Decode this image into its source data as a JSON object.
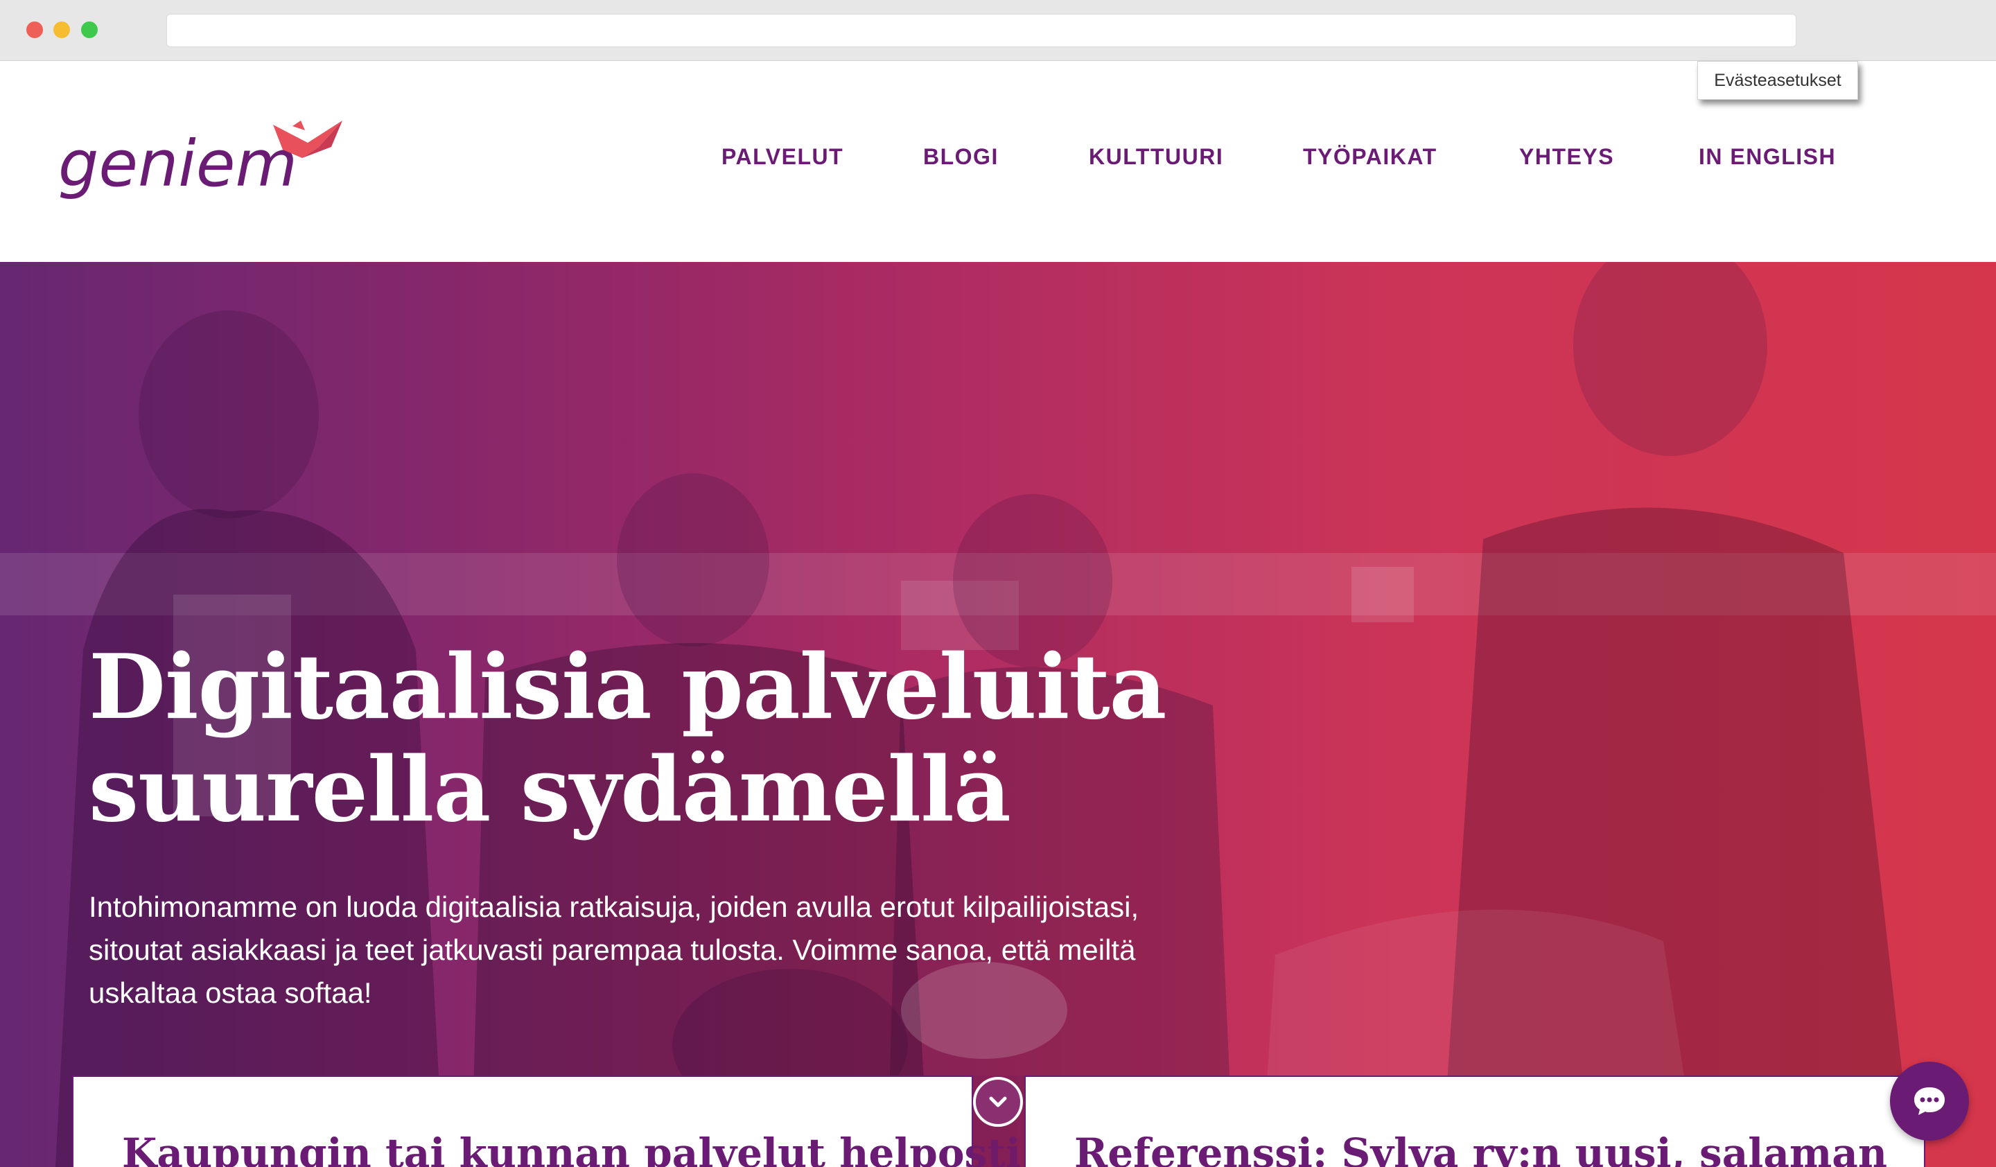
{
  "browser": {
    "buttons": [
      "close",
      "minimize",
      "maximize"
    ],
    "url": ""
  },
  "header": {
    "logo_text": "geniem",
    "cookie_settings": "Evästeasetukset",
    "nav": [
      {
        "label": "PALVELUT"
      },
      {
        "label": "BLOGI"
      },
      {
        "label": "KULTTUURI"
      },
      {
        "label": "TYÖPAIKAT"
      },
      {
        "label": "YHTEYS"
      },
      {
        "label": "IN ENGLISH"
      }
    ]
  },
  "hero": {
    "title": "Digitaalisia palveluita suurella sydämellä",
    "text": "Intohimonamme on luoda digitaalisia ratkaisuja, joiden avulla erotut kilpailijoistasi, sitoutat asiakkaasi ja teet jatkuvasti parempaa tulosta. Voimme sanoa, että meiltä uskaltaa ostaa softaa!"
  },
  "cards": [
    {
      "title": "Kaupungin tai kunnan palvelut helposti"
    },
    {
      "title": "Referenssi: Sylva ry:n uusi, salaman"
    }
  ],
  "icons": {
    "scroll": "chevron-down-icon",
    "chat": "chat-bubble-icon"
  },
  "colors": {
    "brand": "#6a1b74",
    "accent": "#e8505b",
    "hero_left": "#6b2a77",
    "hero_right": "#e23a4d"
  }
}
